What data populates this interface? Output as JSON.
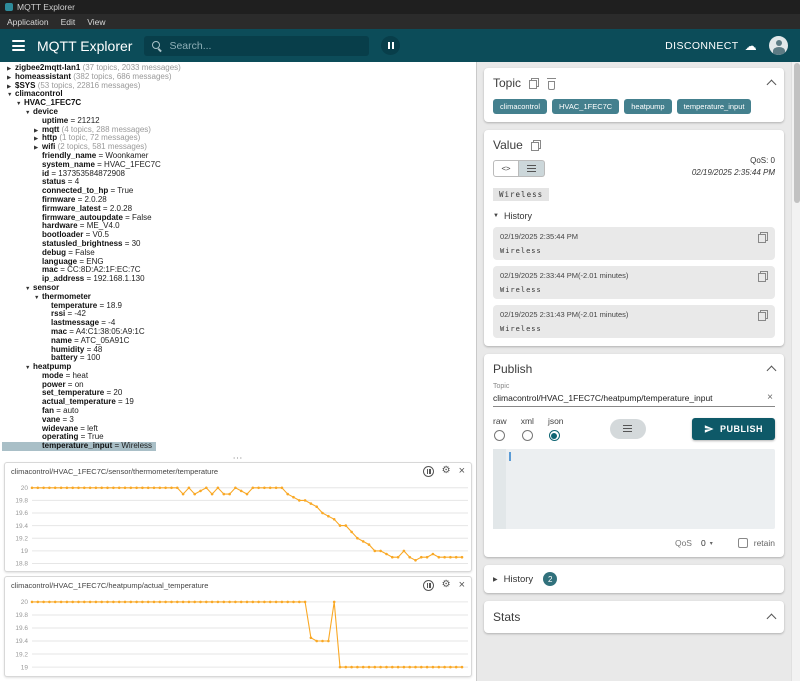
{
  "window": {
    "title": "MQTT Explorer",
    "menu": [
      "Application",
      "Edit",
      "View"
    ]
  },
  "appbar": {
    "title": "MQTT Explorer",
    "search_placeholder": "Search...",
    "disconnect_label": "DISCONNECT"
  },
  "icons": {
    "cloud": "☁",
    "gear": "⚙",
    "close": "×",
    "clear": "×",
    "triangle_down": "▼",
    "triangle_right": "▶",
    "caret_down": "▾",
    "code": "<>",
    "drag_dots": "⋯"
  },
  "tree": {
    "rows": [
      {
        "indent": 0,
        "arrow": "closed",
        "name": "zigbee2mqtt-lan1",
        "value": null,
        "count": "(37 topics, 2033 messages)",
        "selected": false
      },
      {
        "indent": 0,
        "arrow": "closed",
        "name": "homeassistant",
        "value": null,
        "count": "(382 topics, 686 messages)",
        "selected": false
      },
      {
        "indent": 0,
        "arrow": "closed",
        "name": "$SYS",
        "value": null,
        "count": "(53 topics, 22816 messages)",
        "selected": false
      },
      {
        "indent": 0,
        "arrow": "open",
        "name": "climacontrol",
        "value": null,
        "count": null,
        "selected": false
      },
      {
        "indent": 1,
        "arrow": "open",
        "name": "HVAC_1FEC7C",
        "value": null,
        "count": null,
        "selected": false
      },
      {
        "indent": 2,
        "arrow": "open",
        "name": "device",
        "value": null,
        "count": null,
        "selected": false
      },
      {
        "indent": 3,
        "arrow": null,
        "name": "uptime",
        "value": "21212",
        "count": null,
        "selected": false
      },
      {
        "indent": 3,
        "arrow": "closed",
        "name": "mqtt",
        "value": null,
        "count": "(4 topics, 288 messages)",
        "selected": false
      },
      {
        "indent": 3,
        "arrow": "closed",
        "name": "http",
        "value": null,
        "count": "(1 topic, 72 messages)",
        "selected": false
      },
      {
        "indent": 3,
        "arrow": "closed",
        "name": "wifi",
        "value": null,
        "count": "(2 topics, 581 messages)",
        "selected": false
      },
      {
        "indent": 3,
        "arrow": null,
        "name": "friendly_name",
        "value": "Woonkamer",
        "count": null,
        "selected": false
      },
      {
        "indent": 3,
        "arrow": null,
        "name": "system_name",
        "value": "HVAC_1FEC7C",
        "count": null,
        "selected": false
      },
      {
        "indent": 3,
        "arrow": null,
        "name": "id",
        "value": "137353584872908",
        "count": null,
        "selected": false
      },
      {
        "indent": 3,
        "arrow": null,
        "name": "status",
        "value": "4",
        "count": null,
        "selected": false
      },
      {
        "indent": 3,
        "arrow": null,
        "name": "connected_to_hp",
        "value": "True",
        "count": null,
        "selected": false
      },
      {
        "indent": 3,
        "arrow": null,
        "name": "firmware",
        "value": "2.0.28",
        "count": null,
        "selected": false
      },
      {
        "indent": 3,
        "arrow": null,
        "name": "firmware_latest",
        "value": "2.0.28",
        "count": null,
        "selected": false
      },
      {
        "indent": 3,
        "arrow": null,
        "name": "firmware_autoupdate",
        "value": "False",
        "count": null,
        "selected": false
      },
      {
        "indent": 3,
        "arrow": null,
        "name": "hardware",
        "value": "ME_V4.0",
        "count": null,
        "selected": false
      },
      {
        "indent": 3,
        "arrow": null,
        "name": "bootloader",
        "value": "V0.5",
        "count": null,
        "selected": false
      },
      {
        "indent": 3,
        "arrow": null,
        "name": "statusled_brightness",
        "value": "30",
        "count": null,
        "selected": false
      },
      {
        "indent": 3,
        "arrow": null,
        "name": "debug",
        "value": "False",
        "count": null,
        "selected": false
      },
      {
        "indent": 3,
        "arrow": null,
        "name": "language",
        "value": "ENG",
        "count": null,
        "selected": false
      },
      {
        "indent": 3,
        "arrow": null,
        "name": "mac",
        "value": "CC:8D:A2:1F:EC:7C",
        "count": null,
        "selected": false
      },
      {
        "indent": 3,
        "arrow": null,
        "name": "ip_address",
        "value": "192.168.1.130",
        "count": null,
        "selected": false
      },
      {
        "indent": 2,
        "arrow": "open",
        "name": "sensor",
        "value": null,
        "count": null,
        "selected": false
      },
      {
        "indent": 3,
        "arrow": "open",
        "name": "thermometer",
        "value": null,
        "count": null,
        "selected": false
      },
      {
        "indent": 4,
        "arrow": null,
        "name": "temperature",
        "value": "18.9",
        "count": null,
        "selected": false
      },
      {
        "indent": 4,
        "arrow": null,
        "name": "rssi",
        "value": "-42",
        "count": null,
        "selected": false
      },
      {
        "indent": 4,
        "arrow": null,
        "name": "lastmessage",
        "value": "-4",
        "count": null,
        "selected": false
      },
      {
        "indent": 4,
        "arrow": null,
        "name": "mac",
        "value": "A4:C1:38:05:A9:1C",
        "count": null,
        "selected": false
      },
      {
        "indent": 4,
        "arrow": null,
        "name": "name",
        "value": "ATC_05A91C",
        "count": null,
        "selected": false
      },
      {
        "indent": 4,
        "arrow": null,
        "name": "humidity",
        "value": "48",
        "count": null,
        "selected": false
      },
      {
        "indent": 4,
        "arrow": null,
        "name": "battery",
        "value": "100",
        "count": null,
        "selected": false
      },
      {
        "indent": 2,
        "arrow": "open",
        "name": "heatpump",
        "value": null,
        "count": null,
        "selected": false
      },
      {
        "indent": 3,
        "arrow": null,
        "name": "mode",
        "value": "heat",
        "count": null,
        "selected": false
      },
      {
        "indent": 3,
        "arrow": null,
        "name": "power",
        "value": "on",
        "count": null,
        "selected": false
      },
      {
        "indent": 3,
        "arrow": null,
        "name": "set_temperature",
        "value": "20",
        "count": null,
        "selected": false
      },
      {
        "indent": 3,
        "arrow": null,
        "name": "actual_temperature",
        "value": "19",
        "count": null,
        "selected": false
      },
      {
        "indent": 3,
        "arrow": null,
        "name": "fan",
        "value": "auto",
        "count": null,
        "selected": false
      },
      {
        "indent": 3,
        "arrow": null,
        "name": "vane",
        "value": "3",
        "count": null,
        "selected": false
      },
      {
        "indent": 3,
        "arrow": null,
        "name": "widevane",
        "value": "left",
        "count": null,
        "selected": false
      },
      {
        "indent": 3,
        "arrow": null,
        "name": "operating",
        "value": "True",
        "count": null,
        "selected": false
      },
      {
        "indent": 3,
        "arrow": null,
        "name": "temperature_input",
        "value": "Wireless",
        "count": null,
        "selected": true
      }
    ]
  },
  "chart_data": [
    {
      "type": "line",
      "title": "climacontrol/HVAC_1FEC7C/sensor/thermometer/temperature",
      "color": "#f9a825",
      "yticks": [
        20,
        19.8,
        19.6,
        19.4,
        19.2,
        19,
        18.8
      ],
      "ylim": [
        18.76,
        20.06
      ],
      "values": [
        20,
        20,
        20,
        20,
        20,
        20,
        20,
        20,
        20,
        20,
        20,
        20,
        20,
        20,
        20,
        20,
        20,
        20,
        20,
        20,
        20,
        20,
        20,
        20,
        20,
        20,
        19.9,
        20,
        19.9,
        19.95,
        20,
        19.9,
        20,
        19.9,
        19.9,
        20,
        19.95,
        19.9,
        20,
        20,
        20,
        20,
        20,
        20,
        19.9,
        19.85,
        19.8,
        19.8,
        19.75,
        19.7,
        19.6,
        19.55,
        19.5,
        19.4,
        19.4,
        19.3,
        19.2,
        19.15,
        19.1,
        19,
        19,
        18.95,
        18.9,
        18.9,
        19,
        18.9,
        18.85,
        18.9,
        18.9,
        18.95,
        18.9,
        18.9,
        18.9,
        18.9,
        18.9
      ]
    },
    {
      "type": "line",
      "title": "climacontrol/HVAC_1FEC7C/heatpump/actual_temperature",
      "color": "#f9a825",
      "yticks": [
        20,
        19.8,
        19.6,
        19.4,
        19.2,
        19
      ],
      "ylim": [
        18.94,
        20.06
      ],
      "values": [
        20,
        20,
        20,
        20,
        20,
        20,
        20,
        20,
        20,
        20,
        20,
        20,
        20,
        20,
        20,
        20,
        20,
        20,
        20,
        20,
        20,
        20,
        20,
        20,
        20,
        20,
        20,
        20,
        20,
        20,
        20,
        20,
        20,
        20,
        20,
        20,
        20,
        20,
        20,
        20,
        20,
        20,
        20,
        20,
        20,
        20,
        20,
        20,
        19.45,
        19.4,
        19.4,
        19.4,
        20,
        19,
        19,
        19,
        19,
        19,
        19,
        19,
        19,
        19,
        19,
        19,
        19,
        19,
        19,
        19,
        19,
        19,
        19,
        19,
        19,
        19,
        19
      ]
    }
  ],
  "topic": {
    "title": "Topic",
    "chips": [
      "climacontrol",
      "HVAC_1FEC7C",
      "heatpump",
      "temperature_input"
    ]
  },
  "value": {
    "title": "Value",
    "qos": "QoS: 0",
    "timestamp": "02/19/2025 2:35:44 PM",
    "payload": "Wireless",
    "history_label": "History",
    "history": [
      {
        "time": "02/19/2025 2:35:44 PM",
        "payload": "Wireless"
      },
      {
        "time": "02/19/2025 2:33:44 PM(-2.01 minutes)",
        "payload": "Wireless"
      },
      {
        "time": "02/19/2025 2:31:43 PM(-2.01 minutes)",
        "payload": "Wireless"
      }
    ]
  },
  "publish": {
    "title": "Publish",
    "topic_label": "Topic",
    "topic_value": "climacontrol/HVAC_1FEC7C/heatpump/temperature_input",
    "formats": [
      "raw",
      "xml",
      "json"
    ],
    "selected_format": "json",
    "publish_label": "PUBLISH",
    "qos_label": "QoS",
    "qos_value": "0",
    "retain_label": "retain"
  },
  "history_section": {
    "label": "History",
    "badge": "2"
  },
  "stats": {
    "title": "Stats"
  }
}
